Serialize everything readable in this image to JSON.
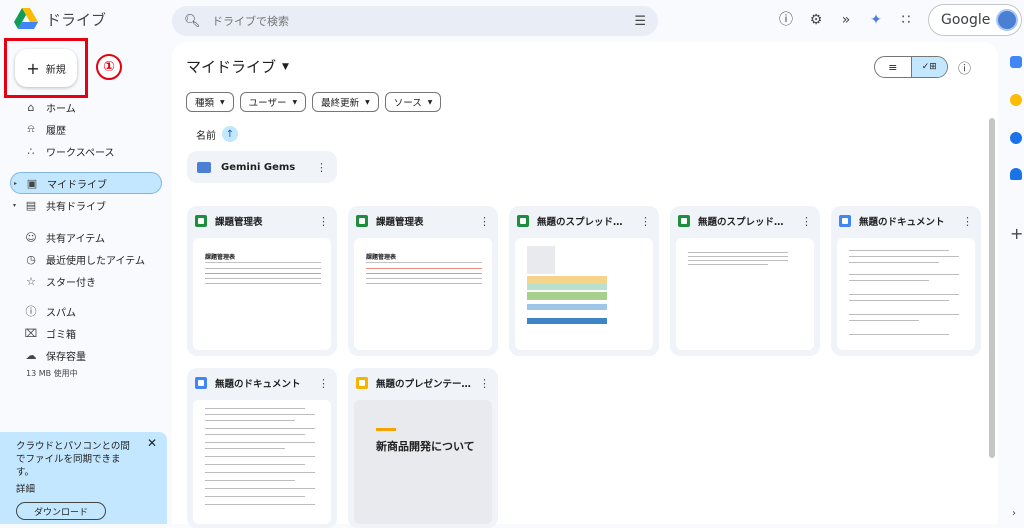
{
  "app": {
    "title": "ドライブ"
  },
  "search": {
    "placeholder": "ドライブで検索"
  },
  "account": {
    "label": "Google"
  },
  "new_button": {
    "label": "新規"
  },
  "annotation": {
    "step": "①"
  },
  "nav": [
    {
      "label": "ホーム",
      "icon": "home-icon"
    },
    {
      "label": "履歴",
      "icon": "bell-icon"
    },
    {
      "label": "ワークスペース",
      "icon": "workspace-icon"
    },
    {
      "label": "マイドライブ",
      "icon": "my-drive-icon"
    },
    {
      "label": "共有ドライブ",
      "icon": "shared-drive-icon"
    },
    {
      "label": "共有アイテム",
      "icon": "people-icon"
    },
    {
      "label": "最近使用したアイテム",
      "icon": "clock-icon"
    },
    {
      "label": "スター付き",
      "icon": "star-icon"
    },
    {
      "label": "スパム",
      "icon": "spam-icon"
    },
    {
      "label": "ゴミ箱",
      "icon": "trash-icon"
    },
    {
      "label": "保存容量",
      "icon": "cloud-icon"
    }
  ],
  "storage": {
    "used": "13 MB 使用中"
  },
  "sync": {
    "message": "クラウドとパソコンとの間でファイルを同期できます。",
    "detail": "詳細",
    "download": "ダウンロード"
  },
  "main": {
    "title": "マイドライブ",
    "filters": [
      "種類",
      "ユーザー",
      "最終更新",
      "ソース"
    ],
    "sort_label": "名前",
    "folder": "Gemini Gems",
    "files": [
      {
        "name": "課題管理表",
        "type": "sheet"
      },
      {
        "name": "課題管理表",
        "type": "sheet"
      },
      {
        "name": "無題のスプレッドシート",
        "type": "sheet"
      },
      {
        "name": "無題のスプレッドシート",
        "type": "sheet"
      },
      {
        "name": "無題のドキュメント",
        "type": "doc"
      },
      {
        "name": "無題のドキュメント",
        "type": "doc"
      },
      {
        "name": "無題のプレゼンテーション",
        "type": "slide"
      }
    ],
    "thumb_text": {
      "sheet_title": "課題管理表",
      "slide_title": "新商品開発について"
    }
  },
  "colors": {
    "accent": "#c2e7ff",
    "highlight": "#e60012"
  }
}
